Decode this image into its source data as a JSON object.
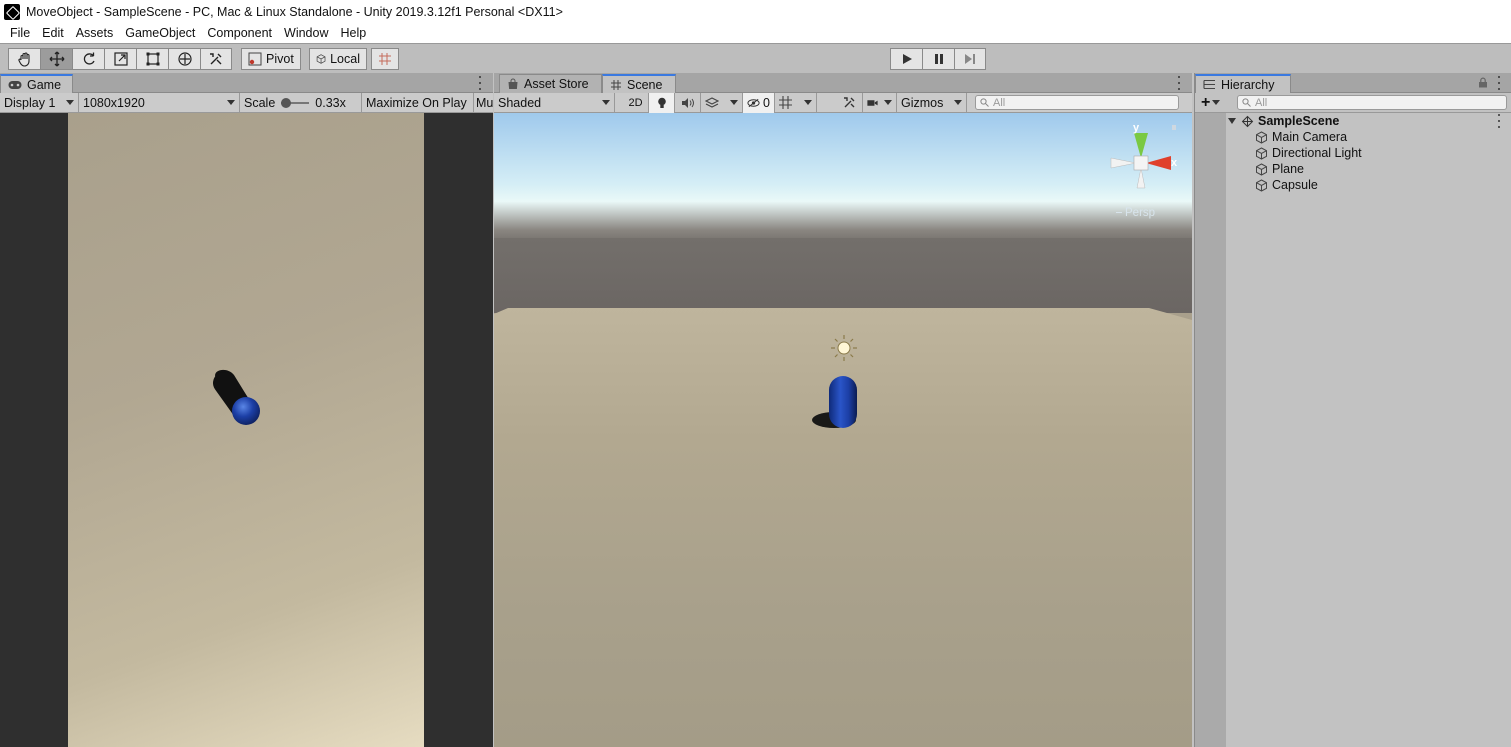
{
  "window": {
    "title": "MoveObject - SampleScene - PC, Mac & Linux Standalone - Unity 2019.3.12f1 Personal <DX11>",
    "icon": "unity-logo-icon"
  },
  "menu": [
    "File",
    "Edit",
    "Assets",
    "GameObject",
    "Component",
    "Window",
    "Help"
  ],
  "toolbar": {
    "tools": [
      "hand-tool",
      "move-tool",
      "rotate-tool",
      "scale-tool",
      "rect-tool",
      "transform-tool",
      "custom-tool"
    ],
    "active_tool": "move-tool",
    "pivot_label": "Pivot",
    "local_label": "Local",
    "play_controls": [
      "play",
      "pause",
      "step"
    ]
  },
  "game_panel": {
    "tab_label": "Game",
    "display": "Display 1",
    "resolution": "1080x1920",
    "scale_label": "Scale",
    "scale_value": "0.33x",
    "maximize_label": "Maximize On Play",
    "mute_label": "Mu"
  },
  "scene_panel": {
    "tabs": [
      "Asset Store",
      "Scene"
    ],
    "active_tab": "Scene",
    "shading": "Shaded",
    "mode_2d": "2D",
    "hidden_count": "0",
    "gizmos_label": "Gizmos",
    "search_placeholder": "All",
    "gizmo_axes": {
      "y": "y",
      "x": "x"
    },
    "perspective": "Persp"
  },
  "hierarchy": {
    "tab_label": "Hierarchy",
    "search_placeholder": "All",
    "add_label": "+",
    "scene_name": "SampleScene",
    "objects": [
      "Main Camera",
      "Directional Light",
      "Plane",
      "Capsule"
    ]
  },
  "colors": {
    "accent": "#3a79e0",
    "capsule_blue": "#1c3fa6",
    "gizmo_x": "#e0402c",
    "gizmo_y": "#7ac943"
  }
}
